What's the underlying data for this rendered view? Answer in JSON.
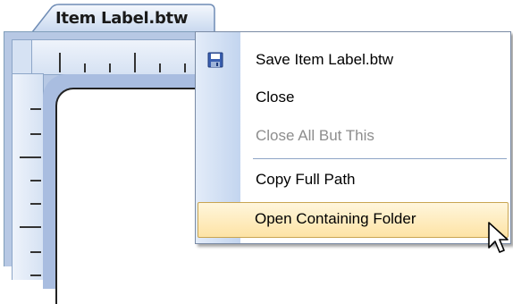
{
  "document_tab": {
    "label": "Item Label.btw"
  },
  "context_menu": {
    "items": [
      {
        "label": "Save Item Label.btw",
        "icon": "save-icon",
        "enabled": true,
        "highlighted": false
      },
      {
        "label": "Close",
        "enabled": true,
        "highlighted": false
      },
      {
        "label": "Close All But This",
        "enabled": false,
        "highlighted": false
      },
      {
        "label": "Copy Full Path",
        "enabled": true,
        "highlighted": false
      },
      {
        "label": "Open Containing Folder",
        "enabled": true,
        "highlighted": true
      }
    ]
  },
  "colors": {
    "menu_gutter": "#c3d5ef",
    "highlight_fill": "#fde3a5",
    "highlight_border": "#c9a552",
    "disabled_text": "#8d8d8d",
    "ruler_frame": "#b7c8e4"
  }
}
